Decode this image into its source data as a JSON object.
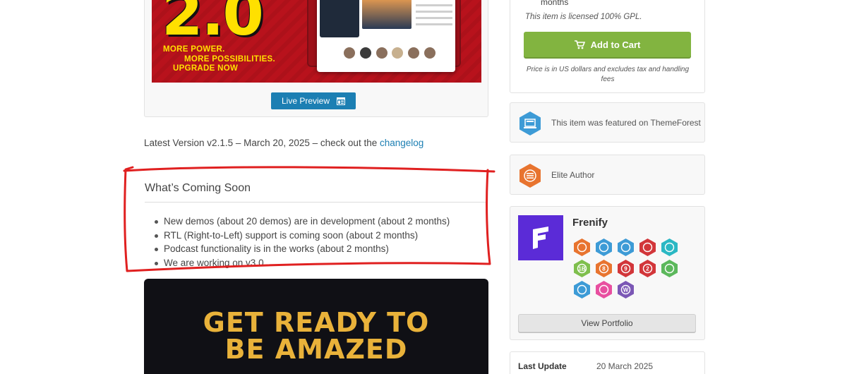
{
  "preview": {
    "banner_version": "2.0",
    "banner_lines": [
      "MORE POWER.",
      "MORE POSSIBILITIES.",
      "UPGRADE NOW"
    ],
    "live_preview_label": "Live Preview"
  },
  "version_info": {
    "text": "Latest Version v2.1.5 – March 20, 2025 – check out the",
    "link_label": "changelog"
  },
  "coming_soon": {
    "title": "What’s Coming Soon",
    "items": [
      "New demos (about 20 demos) are in development (about 2 months)",
      "RTL (Right-to-Left) support is coming soon (about 2 months)",
      "Podcast functionality is in the works (about 2 months)",
      "We are working on v3.0"
    ]
  },
  "promo_banner": {
    "line1": "GET READY TO",
    "line2": "BE AMAZED"
  },
  "purchase": {
    "months_text": "months",
    "license_note": "This item is licensed 100% GPL.",
    "add_to_cart_label": "Add to Cart",
    "price_note": "Price is in US dollars and excludes tax and handling fees"
  },
  "featured": {
    "text": "This item was featured on ThemeForest",
    "icon": "featured-hexagon-icon"
  },
  "elite": {
    "text": "Elite Author",
    "icon": "elite-author-hexagon-icon"
  },
  "author": {
    "name": "Frenify",
    "badges": [
      {
        "name": "elite-author-badge",
        "color": "#e8742f",
        "label": ""
      },
      {
        "name": "featured-item-badge",
        "color": "#3d9bd6",
        "label": ""
      },
      {
        "name": "featured-file-badge",
        "color": "#3d9bd6",
        "label": ""
      },
      {
        "name": "bowtie-red-badge",
        "color": "#d2363a",
        "label": ""
      },
      {
        "name": "bowtie-teal-badge",
        "color": "#2bb8c4",
        "label": ""
      },
      {
        "name": "sales-1b-badge",
        "color": "#7fbf4d",
        "label": "1B"
      },
      {
        "name": "years-8-badge",
        "color": "#e8742f",
        "label": "8"
      },
      {
        "name": "paw-badge",
        "color": "#d2363a",
        "label": "9"
      },
      {
        "name": "exclusive-badge",
        "color": "#d2363a",
        "label": "2"
      },
      {
        "name": "pulse-badge",
        "color": "#5cb85c",
        "label": ""
      },
      {
        "name": "bolt-badge",
        "color": "#3d9bd6",
        "label": ""
      },
      {
        "name": "heart-badge",
        "color": "#e84fa0",
        "label": ""
      },
      {
        "name": "rocket-badge",
        "color": "#7b57b5",
        "label": "W"
      }
    ],
    "portfolio_label": "View Portfolio"
  },
  "update": {
    "label": "Last Update",
    "value": "20 March 2025"
  }
}
